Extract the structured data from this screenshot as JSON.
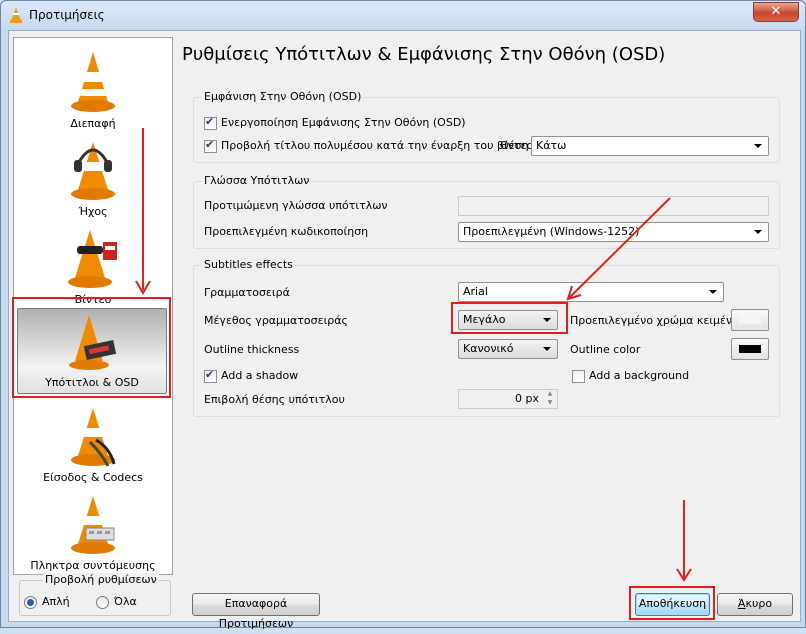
{
  "window": {
    "title": "Προτιμήσεις",
    "close_label": "✕"
  },
  "sidebar": {
    "items": [
      {
        "label": "Διεπαφή",
        "icon": "vlc-cone-icon"
      },
      {
        "label": "Ήχος",
        "icon": "vlc-cone-headphones-icon"
      },
      {
        "label": "Βίντεο",
        "icon": "vlc-cone-glasses-icon"
      },
      {
        "label": "Υπότιτλοι & OSD",
        "icon": "vlc-cone-subtitles-icon",
        "selected": true
      },
      {
        "label": "Είσοδος & Codecs",
        "icon": "vlc-cone-cable-icon"
      },
      {
        "label": "Πληκτρα συντόμευσης",
        "icon": "vlc-cone-keyboard-icon"
      }
    ],
    "view_mode": {
      "title": "Προβολή ρυθμίσεων",
      "simple": "Απλή",
      "all": "Όλα",
      "selected": "simple"
    }
  },
  "page_title": "Ρυθμίσεις Υπότιτλων & Εμφάνισης Στην Οθόνη (OSD)",
  "osd": {
    "title": "Εμφάνιση Στην Οθόνη (OSD)",
    "enable_label": "Ενεργοποίηση Εμφάνισης Στην Οθόνη (OSD)",
    "enable_checked": true,
    "show_title_label": "Προβολή τίτλου πολυμέσου κατά την έναρξη του βίντεο",
    "show_title_checked": true,
    "position_label": "Θέση",
    "position_value": "Κάτω"
  },
  "language": {
    "title": "Γλώσσα Υπότιτλων",
    "preferred_label": "Προτιμώμενη γλώσσα υπότιτλων",
    "preferred_value": "",
    "encoding_label": "Προεπιλεγμένη κωδικοποίηση",
    "encoding_value": "Προεπιλεγμένη (Windows-1252)"
  },
  "effects": {
    "title": "Subtitles effects",
    "font_label": "Γραμματοσειρά",
    "font_value": "Arial",
    "size_label": "Μέγεθος γραμματοσειράς",
    "size_value": "Μεγάλο",
    "text_color_label": "Προεπιλεγμένο χρώμα κειμένου",
    "text_color": "#f4f4f4",
    "outline_label": "Outline thickness",
    "outline_value": "Κανονικό",
    "outline_color_label": "Outline color",
    "outline_color": "#000000",
    "shadow_label": "Add a shadow",
    "shadow_checked": true,
    "background_label": "Add a background",
    "background_checked": false,
    "position_label": "Επιβολή θέσης υπότιτλου",
    "position_value": "0 px"
  },
  "buttons": {
    "reset": "Επαναφορά Προτιμήσεων",
    "save": "Αποθήκευση",
    "cancel_prefix": "",
    "cancel_underlined": "Ά",
    "cancel_rest": "κυρο"
  },
  "colors": {
    "annotation": "#e21f1f",
    "accent": "#2a5da8"
  }
}
